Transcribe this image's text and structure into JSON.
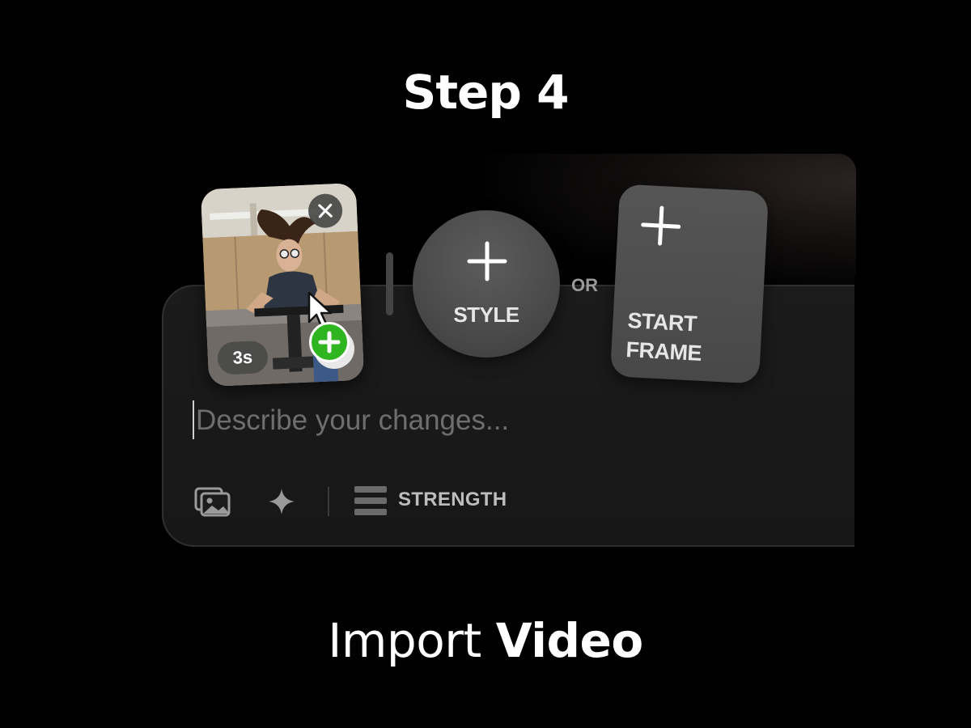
{
  "header": {
    "title": "Step 4"
  },
  "media": {
    "thumbnail_duration": "3s",
    "remove_icon": "close-icon",
    "drop_icon": "plus-icon"
  },
  "style_button": {
    "label": "STYLE",
    "icon": "plus-icon"
  },
  "separator_text": "OR",
  "start_frame_button": {
    "label_line1": "START",
    "label_line2": "FRAME",
    "icon": "plus-icon"
  },
  "prompt": {
    "placeholder": "Describe your changes...",
    "value": ""
  },
  "toolbar": {
    "gallery_icon": "images-icon",
    "enhance_icon": "sparkle-icon",
    "strength_icon": "strength-bars-icon",
    "strength_label": "STRENGTH"
  },
  "caption": {
    "light": "Import",
    "bold": "Video"
  },
  "colors": {
    "background": "#000000",
    "panel": "#1b1b1b",
    "drop_add": "#2fb51f"
  }
}
